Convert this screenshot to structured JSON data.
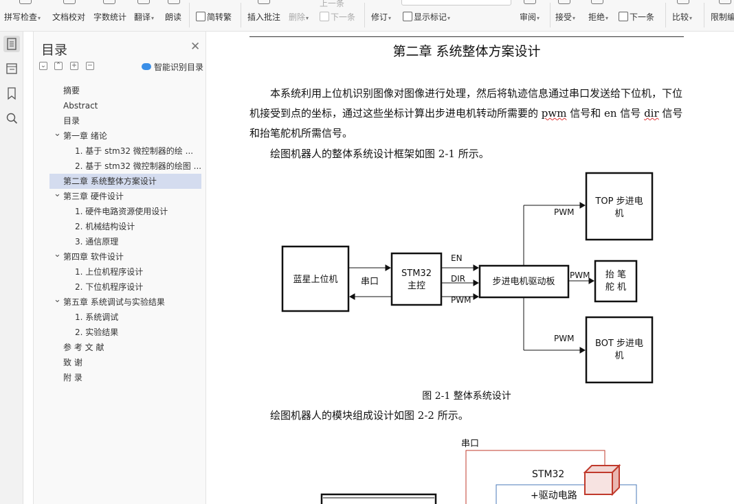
{
  "ribbon": {
    "spell_check": "拼写检查",
    "doc_proof": "文档校对",
    "word_count": "字数统计",
    "translate": "翻译",
    "read_aloud": "朗读",
    "trad_simp": "简转繁",
    "insert_comment": "插入批注",
    "delete": "删除",
    "prev": "上一条",
    "next": "下一条",
    "revise": "修订",
    "show_marks": "显示标记",
    "review": "审阅",
    "accept": "接受",
    "reject": "拒绝",
    "next2": "下一条",
    "compare": "比较",
    "restrict": "限制编"
  },
  "sidebar_panel": {
    "title": "目录",
    "smart_label": "智能识别目录",
    "toc": [
      {
        "label": "摘要",
        "level": 1,
        "toggle": ""
      },
      {
        "label": "Abstract",
        "level": 1,
        "toggle": ""
      },
      {
        "label": "目录",
        "level": 1,
        "toggle": ""
      },
      {
        "label": "第一章 绪论",
        "level": 1,
        "toggle": "v"
      },
      {
        "label": "1. 基于 stm32 微控制器的绘 ...",
        "level": 2,
        "toggle": ""
      },
      {
        "label": "2. 基于 stm32 微控制器的绘图 ...",
        "level": 2,
        "toggle": ""
      },
      {
        "label": "第二章 系统整体方案设计",
        "level": 1,
        "toggle": "",
        "selected": true
      },
      {
        "label": "第三章 硬件设计",
        "level": 1,
        "toggle": "v"
      },
      {
        "label": "1. 硬件电路资源使用设计",
        "level": 2,
        "toggle": ""
      },
      {
        "label": "2. 机械结构设计",
        "level": 2,
        "toggle": ""
      },
      {
        "label": "3. 通信原理",
        "level": 2,
        "toggle": ""
      },
      {
        "label": "第四章 软件设计",
        "level": 1,
        "toggle": "v"
      },
      {
        "label": "1. 上位机程序设计",
        "level": 2,
        "toggle": ""
      },
      {
        "label": "2. 下位机程序设计",
        "level": 2,
        "toggle": ""
      },
      {
        "label": "第五章 系统调试与实验结果",
        "level": 1,
        "toggle": "v"
      },
      {
        "label": "1. 系统调试",
        "level": 2,
        "toggle": ""
      },
      {
        "label": "2. 实验结果",
        "level": 2,
        "toggle": ""
      },
      {
        "label": "参 考 文 献",
        "level": 1,
        "toggle": ""
      },
      {
        "label": "致 谢",
        "level": 1,
        "toggle": ""
      },
      {
        "label": "附 录",
        "level": 1,
        "toggle": ""
      }
    ]
  },
  "document": {
    "header_text": "第二章 系统整体方案设计",
    "heading": "第二章  系统整体方案设计",
    "para1_a": "本系统利用上位机识别图像对图像进行处理，然后将轨迹信息通过串口发送给下位机，下位机接受到点的坐标，通过这些坐标计算出步进电机转动所需要的 ",
    "para1_pwm": "pwm",
    "para1_b": " 信号和  en 信号 ",
    "para1_dir": "dir",
    "para1_c": " 信号和抬笔舵机所需信号。",
    "para2": "绘图机器人的整体系统设计框架如图 2-1 所示。",
    "figure_caption": "图  2-1 整体系统设计",
    "para3": "绘图机器人的模块组成设计如图 2-2 所示。",
    "diagram1": {
      "host": "蓝星上位机",
      "serial": "串口",
      "mcu_line1": "STM32",
      "mcu_line2": "主控",
      "en": "EN",
      "dir": "DIR",
      "pwm": "PWM",
      "driver": "步进电机驱动板",
      "top_pwm": "PWM",
      "top_motor_a": "TOP 步进电",
      "top_motor_b": "机",
      "pen_pwm": "PWM",
      "pen_a": "抬  笔",
      "pen_b": "舵  机",
      "bot_pwm": "PWM",
      "bot_motor_a": "BOT 步进电",
      "bot_motor_b": "机"
    },
    "diagram2": {
      "serial": "串口",
      "mcu": "STM32",
      "driver": "+驱动电路"
    }
  }
}
